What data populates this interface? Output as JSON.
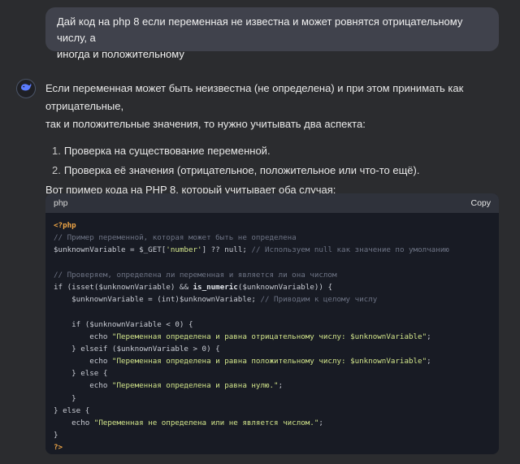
{
  "user_message": {
    "line1": "Дай код на php 8 если переменная не известна и может ровнятся отрицательному числу, а",
    "line2": "иногда и положительному"
  },
  "bot_message": {
    "intro_line1": "Если переменная может быть неизвестна (не определена) и при этом принимать как отрицательные,",
    "intro_line2": "так и положительные значения, то нужно учитывать два аспекта:",
    "steps": [
      {
        "num": "1.",
        "text": "Проверка на существование переменной."
      },
      {
        "num": "2.",
        "text": "Проверка её значения (отрицательное, положительное или что-то ещё)."
      }
    ],
    "code_intro": "Вот пример кода на PHP 8, который учитывает оба случая:"
  },
  "code_block": {
    "language": "php",
    "copy_label": "Copy",
    "lines": [
      "<?php",
      "// Пример переменной, которая может быть не определена",
      "$unknownVariable = $_GET['number'] ?? null; // Используем null как значение по умолчанию",
      "",
      "// Проверяем, определена ли переменная и является ли она числом",
      "if (isset($unknownVariable) && is_numeric($unknownVariable)) {",
      "    $unknownVariable = (int)$unknownVariable; // Приводим к целому числу",
      "",
      "    if ($unknownVariable < 0) {",
      "        echo \"Переменная определена и равна отрицательному числу: $unknownVariable\";",
      "    } elseif ($unknownVariable > 0) {",
      "        echo \"Переменная определена и равна положительному числу: $unknownVariable\";",
      "    } else {",
      "        echo \"Переменная определена и равна нулю.\";",
      "    }",
      "} else {",
      "    echo \"Переменная не определена или не является числом.\";",
      "}",
      "?>"
    ]
  },
  "colors": {
    "background": "#2b2c2f",
    "user_bubble": "#40424c",
    "code_background": "#181b24",
    "code_header": "#2f323b",
    "php_tag": "#f0a646",
    "comment": "#6d7384",
    "string": "#d1e48a"
  },
  "icons": {
    "bot_avatar": "whale-icon"
  }
}
